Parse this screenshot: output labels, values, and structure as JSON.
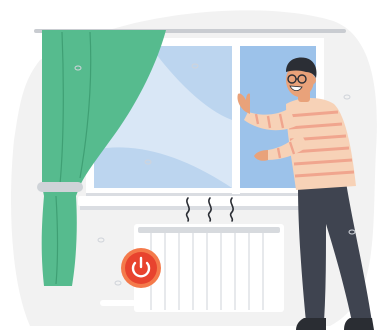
{
  "scene": {
    "subject": "man-opening-window",
    "colors": {
      "backdrop": "#f2f2f2",
      "curtain": "#56bb8e",
      "curtain_dark": "#3f9f74",
      "glass_light": "#d9e7f6",
      "glass_mid": "#bcd5ef",
      "glass_open": "#9cc2ea",
      "frame": "#ffffff",
      "frame_shadow": "#dadde2",
      "rod": "#c9ccd1",
      "tieback": "#cfd3d8",
      "radiator": "#ffffff",
      "radiator_line": "#d7dade",
      "power_button": "#e8432e",
      "power_ring": "#f47a4b",
      "shirt": "#f7d2b7",
      "shirt_stripes": "#f0a58e",
      "trousers": "#3f4450",
      "skin": "#e9a27a",
      "hair": "#2b2e35",
      "shoes": "#2a2d33",
      "heat_waves": "#2b2e35"
    },
    "icons": [
      "power-icon",
      "heat-waves-icon"
    ]
  }
}
